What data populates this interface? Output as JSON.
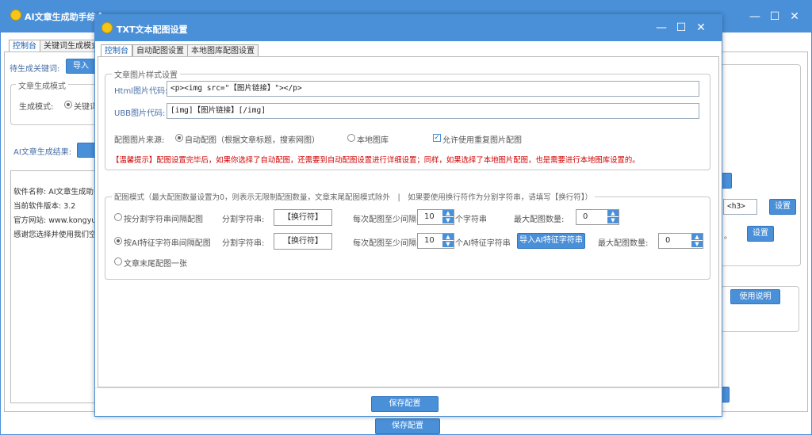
{
  "back_window": {
    "title": "AI文章生成助手综合",
    "tabs": [
      "控制台",
      "关键词生成模式"
    ],
    "keyword_label": "待生成关键词:",
    "import_button": "导入",
    "mode_group_legend": "文章生成模式",
    "mode_label": "生成模式:",
    "mode_option": "关键词",
    "result_label": "AI文章生成结果:",
    "log_lines": [
      "软件名称: AI文章生成助",
      "当前软件版本: 3.2",
      "官方网站: www.kongyue.",
      "感谢您选择并使用我们空"
    ],
    "right_tag_value": "<h3>",
    "right_settings_button": "设置",
    "right_settings_button2": "设置",
    "usage_button": "使用说明",
    "bottom_button": "保存配置"
  },
  "dialog": {
    "title": "TXT文本配图设置",
    "tabs": [
      {
        "label": "控制台",
        "active": true
      },
      {
        "label": "自动配图设置",
        "active": false
      },
      {
        "label": "本地图库配图设置",
        "active": false
      }
    ],
    "style_group": {
      "legend": "文章图片样式设置",
      "html_label": "Html图片代码:",
      "html_value": "<p><img src=\"【图片链接】\"></p>",
      "ubb_label": "UBB图片代码:",
      "ubb_value": "[img]【图片链接】[/img]",
      "source_label": "配图图片来源:",
      "source_options": [
        {
          "label": "自动配图（根据文章标题，搜索网图）",
          "selected": true
        },
        {
          "label": "本地图库",
          "selected": false
        }
      ],
      "allow_repeat_label": "允许使用重复图片配图",
      "allow_repeat_checked": true,
      "warning": "【温馨提示】配图设置完毕后，如果你选择了自动配图，还需要到自动配图设置进行详细设置；同样，如果选择了本地图片配图，也是需要进行本地图库设置的。"
    },
    "mode_group": {
      "legend": "配图模式（最大配图数量设置为0，则表示无限制配图数量，文章末尾配图模式除外　|　如果要使用换行符作为分割字符串，请填写【换行符】）",
      "rows": [
        {
          "option": "按分割字符串间隔配图",
          "selected": false,
          "sep_label": "分割字符串:",
          "sep_value": "【换行符】",
          "interval_label": "每次配图至少间隔",
          "interval_value": "10",
          "interval_unit": "个字符串",
          "max_label": "最大配图数量:",
          "max_value": "0"
        },
        {
          "option": "按AI特征字符串间隔配图",
          "selected": true,
          "sep_label": "分割字符串:",
          "sep_value": "【换行符】",
          "interval_label": "每次配图至少间隔",
          "interval_value": "10",
          "interval_unit": "个AI特征字符串",
          "import_button": "导入AI特征字符串",
          "max_label": "最大配图数量:",
          "max_value": "0"
        }
      ],
      "end_option": "文章末尾配图一张",
      "end_selected": false
    },
    "save_button": "保存配置"
  },
  "colors": {
    "titlebar": "#4a90d9",
    "button": "#4a90d9",
    "warning": "#d00000",
    "tab_active": "#1a5fb4"
  }
}
